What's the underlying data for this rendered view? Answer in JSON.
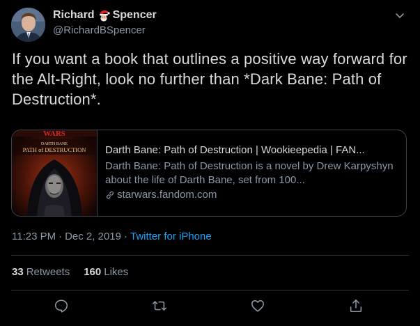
{
  "user": {
    "name_first": "Richard",
    "name_last": "Spencer",
    "name_emoji": "santa-icon",
    "handle": "@RichardBSpencer",
    "avatar": "avatar-photo"
  },
  "tweet": {
    "text": "If you want a book that outlines a positive way forward for the Alt-Right, look no further than *Dark Bane: Path of Destruction*."
  },
  "card": {
    "thumb_lines": [
      "WARS",
      "DARTH BANE",
      "PATH of DESTRUCTION"
    ],
    "title": "Darth Bane: Path of Destruction | Wookieepedia | FAN...",
    "description": "Darth Bane: Path of Destruction is a novel by Drew Karpyshyn about the life of Darth Bane, set from 100...",
    "domain": "starwars.fandom.com",
    "domain_icon": "link-icon"
  },
  "meta": {
    "time": "11:23 PM",
    "separator": "·",
    "date": "Dec 2, 2019",
    "separator2": "·",
    "source": "Twitter for iPhone"
  },
  "stats": {
    "retweets_count": "33",
    "retweets_label": "Retweets",
    "likes_count": "160",
    "likes_label": "Likes"
  },
  "actions": [
    "reply-icon",
    "retweet-icon",
    "like-icon",
    "share-icon"
  ],
  "colors": {
    "background": "#000000",
    "text": "#d9d9d9",
    "secondary": "#8b98a5",
    "accent": "#1da1f2",
    "border": "#38444d"
  }
}
